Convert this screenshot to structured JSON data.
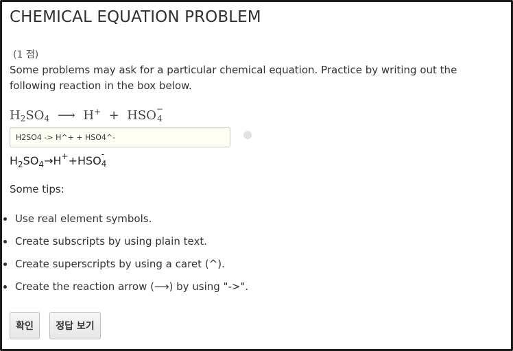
{
  "problem": {
    "title": "CHEMICAL EQUATION PROBLEM",
    "points": "(1 점)",
    "description": "Some problems may ask for a particular chemical equation. Practice by writing out the following reaction in the box below."
  },
  "equation": {
    "reactant_a": "H",
    "reactant_a_sub": "2",
    "reactant_b": "SO",
    "reactant_b_sub": "4",
    "arrow": "⟶",
    "product1": "H",
    "product1_sup": "+",
    "plus": "+",
    "product2": "HSO",
    "product2_sup": "−",
    "product2_sub": "4"
  },
  "answer": {
    "value": "H2SO4 -> H^+ + HSO4^-"
  },
  "preview": {
    "p1": "H",
    "p1_sub": "2",
    "p2": "SO",
    "p2_sub": "4",
    "arrow": "→",
    "p3": "H",
    "p3_sup": "+",
    "plus": "+",
    "p4": "HSO",
    "p4_sub": "4",
    "p4_sup": "-"
  },
  "tips": {
    "heading": "Some tips:",
    "items": [
      "Use real element symbols.",
      "Create subscripts by using plain text.",
      "Create superscripts by using a caret (^).",
      "Create the reaction arrow (⟶) by using \"->\"."
    ]
  },
  "buttons": {
    "check": "확인",
    "show_answer": "정답 보기"
  }
}
